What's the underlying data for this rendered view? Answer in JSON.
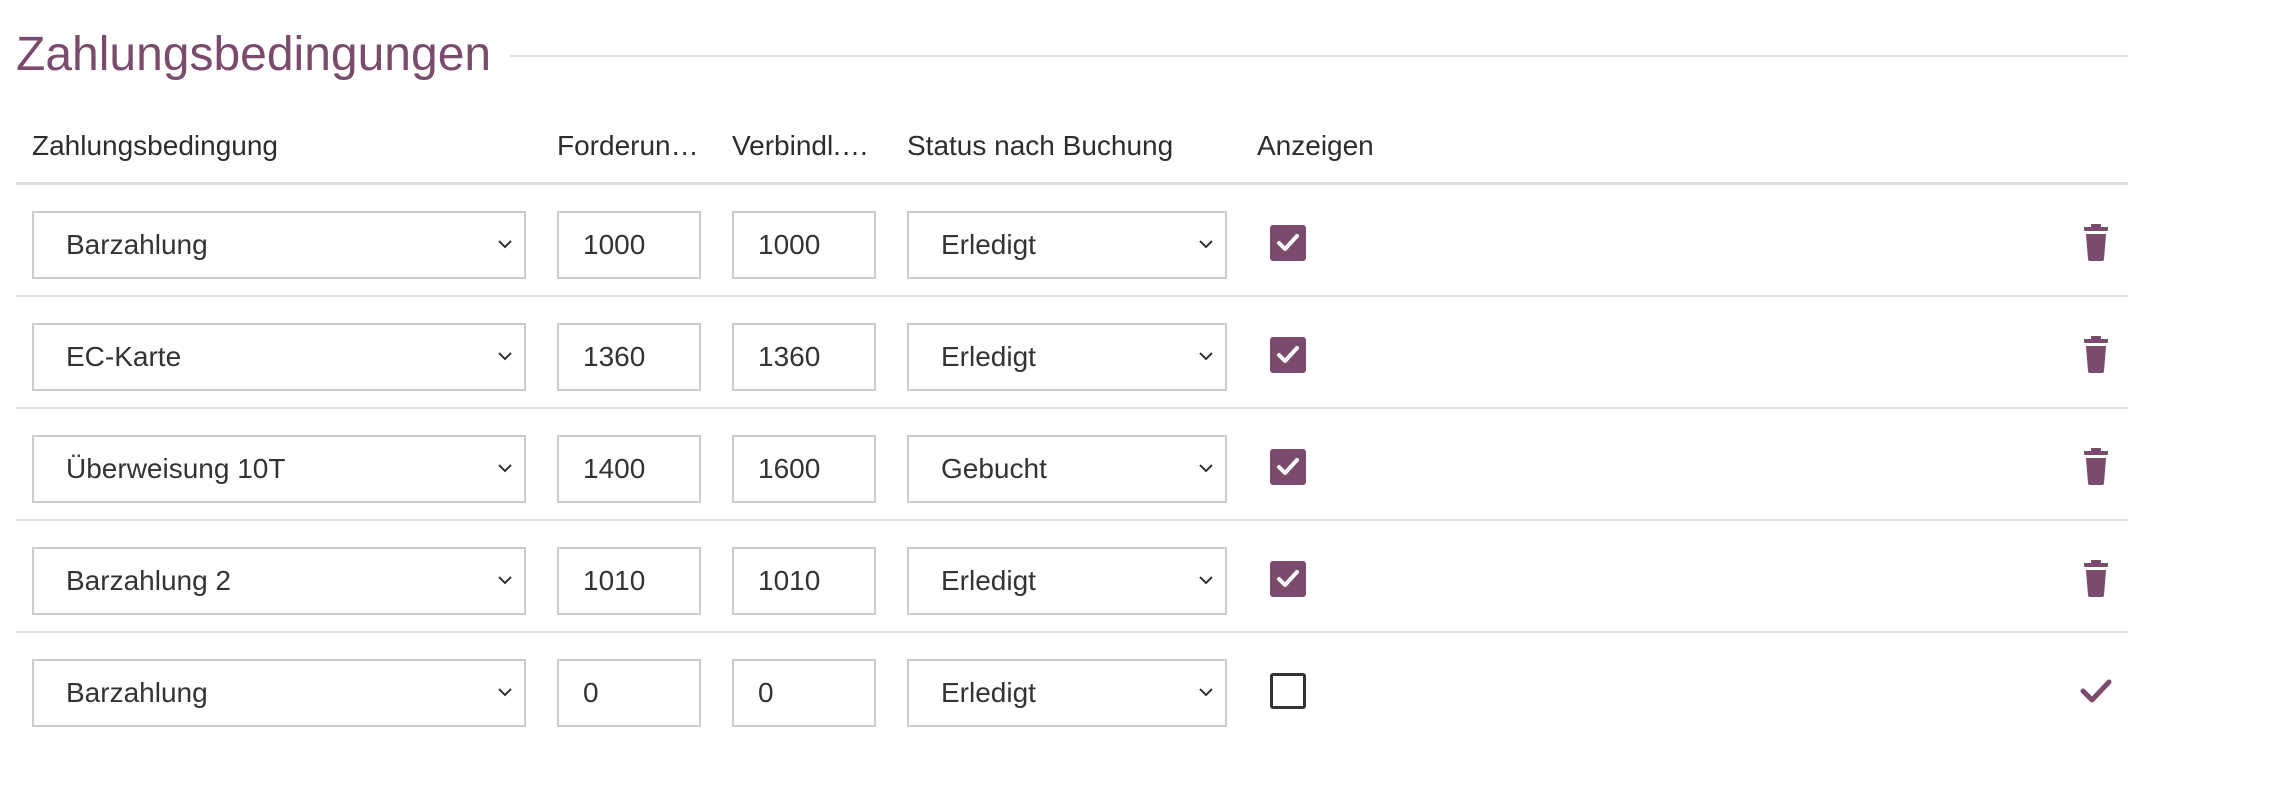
{
  "section": {
    "title": "Zahlungsbedingungen"
  },
  "table": {
    "headers": {
      "payment_term": "Zahlungsbedingung",
      "receivable": "Forderun…",
      "liability": "Verbindl. …",
      "status_after_posting": "Status nach Buchung",
      "show": "Anzeigen"
    },
    "rows": [
      {
        "payment_term": "Barzahlung",
        "receivable": "1000",
        "liability": "1000",
        "status": "Erledigt",
        "show": true,
        "action_icon": "trash-icon"
      },
      {
        "payment_term": "EC-Karte",
        "receivable": "1360",
        "liability": "1360",
        "status": "Erledigt",
        "show": true,
        "action_icon": "trash-icon"
      },
      {
        "payment_term": "Überweisung 10T",
        "receivable": "1400",
        "liability": "1600",
        "status": "Gebucht",
        "show": true,
        "action_icon": "trash-icon"
      },
      {
        "payment_term": "Barzahlung 2",
        "receivable": "1010",
        "liability": "1010",
        "status": "Erledigt",
        "show": true,
        "action_icon": "trash-icon"
      },
      {
        "payment_term": "Barzahlung",
        "receivable": "0",
        "liability": "0",
        "status": "Erledigt",
        "show": false,
        "action_icon": "checkmark-icon"
      }
    ]
  },
  "colors": {
    "accent": "#7b4b6e",
    "border": "#cccccc",
    "divider": "#e2e2e2",
    "text": "#333333"
  }
}
